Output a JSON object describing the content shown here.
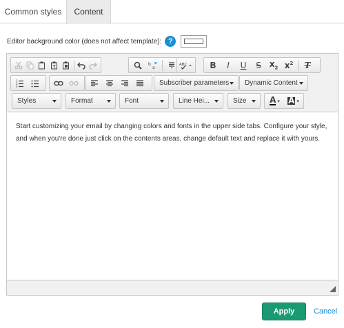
{
  "tabs": [
    {
      "label": "Common styles",
      "active": false
    },
    {
      "label": "Content",
      "active": true
    }
  ],
  "background": {
    "label": "Editor background color (does not affect template):",
    "help_symbol": "?",
    "color": "#ffffff"
  },
  "toolbar": {
    "row1": {
      "clipboard": [
        "cut-icon",
        "copy-icon",
        "paste-icon",
        "paste-text-icon",
        "paste-word-icon"
      ],
      "history": [
        "undo-icon",
        "redo-icon"
      ],
      "find": [
        "find-icon",
        "replace-icon"
      ],
      "misc": [
        "select-all-icon"
      ],
      "spell_label": "ABC",
      "format": {
        "bold": "B",
        "italic": "I",
        "underline": "U",
        "strike": "S",
        "subscript": "x",
        "superscript": "x",
        "remove": "T"
      }
    },
    "row2": {
      "lists": [
        "numbered-list-icon",
        "bulleted-list-icon"
      ],
      "links": [
        "link-icon",
        "unlink-icon"
      ],
      "align": [
        "align-left-icon",
        "align-center-icon",
        "align-right-icon",
        "align-justify-icon"
      ],
      "subscriber_parameters": "Subscriber parameters",
      "dynamic_content": "Dynamic Content"
    },
    "row3": {
      "styles": "Styles",
      "format": "Format",
      "font": "Font",
      "line_height": "Line Hei...",
      "size": "Size",
      "text_color_letter": "A",
      "bg_color_letter": "A"
    }
  },
  "content": {
    "text": "Start customizing your email by changing colors and fonts in the upper side tabs. Configure your style, and when you're done just click on the contents areas, change default text and replace it with yours."
  },
  "buttons": {
    "apply": "Apply",
    "cancel": "Cancel"
  },
  "colors": {
    "accent": "#1a9a72",
    "link": "#1a8fd4"
  }
}
